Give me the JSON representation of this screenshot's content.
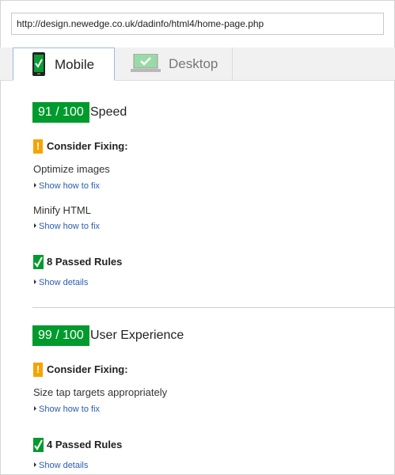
{
  "url": "http://design.newedge.co.uk/dadinfo/html4/home-page.php",
  "tabs": [
    {
      "label": "Mobile",
      "active": true
    },
    {
      "label": "Desktop",
      "active": false
    }
  ],
  "speed": {
    "score": "91 / 100",
    "label": "Speed",
    "consider_label": "Consider Fixing:",
    "rules": [
      {
        "name": "Optimize images",
        "link": "Show how to fix"
      },
      {
        "name": "Minify HTML",
        "link": "Show how to fix"
      }
    ],
    "passed_label": "8 Passed Rules",
    "details_link": "Show details"
  },
  "ux": {
    "score": "99 / 100",
    "label": "User Experience",
    "consider_label": "Consider Fixing:",
    "rules": [
      {
        "name": "Size tap targets appropriately",
        "link": "Show how to fix"
      }
    ],
    "passed_label": "4 Passed Rules",
    "details_link": "Show details"
  },
  "colors": {
    "score_bg": "#009a2d",
    "warning": "#f7a300",
    "link": "#2a5db0"
  }
}
